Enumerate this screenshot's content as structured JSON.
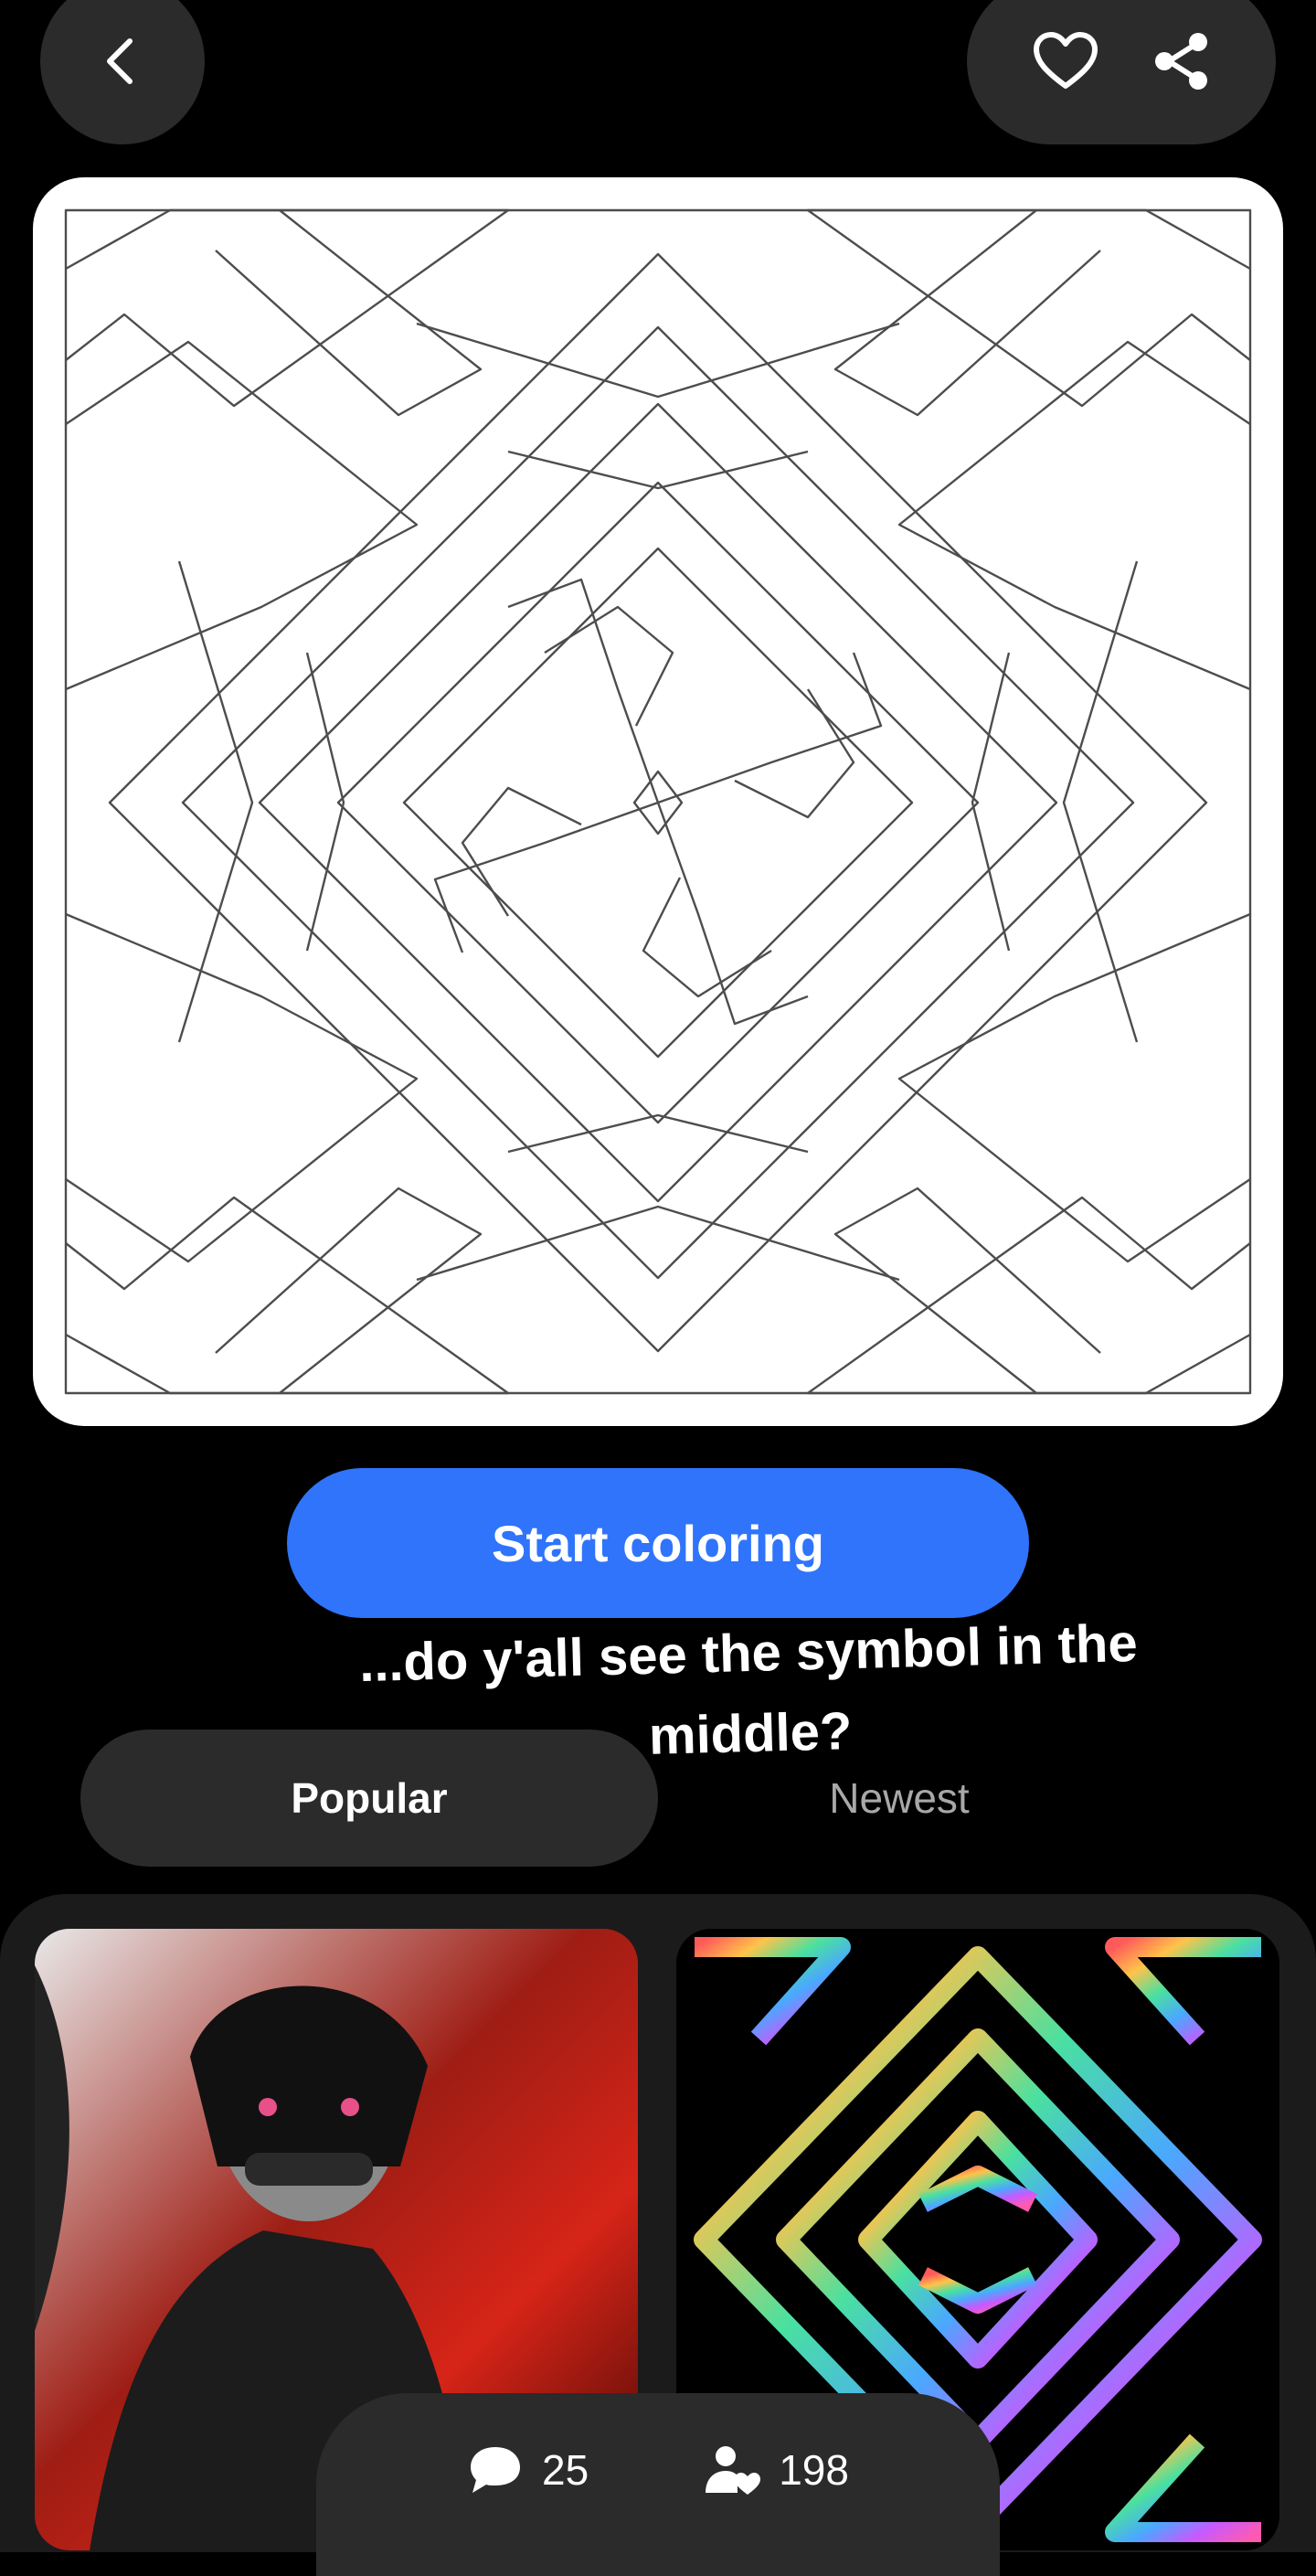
{
  "icons": {
    "back": "chevron-left-icon",
    "like": "heart-icon",
    "share": "share-icon",
    "comment": "speech-bubble-icon",
    "colorists": "person-heart-icon"
  },
  "colors": {
    "accent": "#2f74fb",
    "background": "#000000",
    "surface": "#2b2b2b"
  },
  "main": {
    "start_label": "Start coloring",
    "caption": "...do y'all see the symbol in the middle?"
  },
  "tabs": [
    {
      "label": "Popular",
      "selected": true
    },
    {
      "label": "Newest",
      "selected": false
    }
  ],
  "stats": {
    "comments": "25",
    "colorists": "198"
  }
}
